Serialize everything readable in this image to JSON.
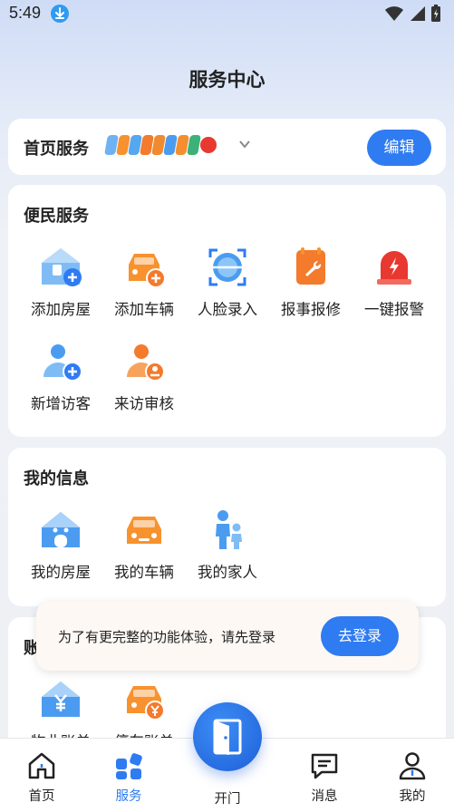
{
  "status_bar": {
    "time": "5:49"
  },
  "page_title": "服务中心",
  "home_services": {
    "title": "首页服务",
    "edit_label": "编辑"
  },
  "convenience": {
    "title": "便民服务",
    "items": [
      {
        "label": "添加房屋",
        "icon": "add-house-icon"
      },
      {
        "label": "添加车辆",
        "icon": "add-car-icon"
      },
      {
        "label": "人脸录入",
        "icon": "face-scan-icon"
      },
      {
        "label": "报事报修",
        "icon": "repair-icon"
      },
      {
        "label": "一键报警",
        "icon": "alarm-icon"
      },
      {
        "label": "新增访客",
        "icon": "add-visitor-icon"
      },
      {
        "label": "来访审核",
        "icon": "visitor-review-icon"
      }
    ]
  },
  "my_info": {
    "title": "我的信息",
    "items": [
      {
        "label": "我的房屋",
        "icon": "house-icon"
      },
      {
        "label": "我的车辆",
        "icon": "car-icon"
      },
      {
        "label": "我的家人",
        "icon": "family-icon"
      }
    ]
  },
  "bills": {
    "title_partial": "账",
    "items": [
      {
        "label": "物业账单",
        "icon": "property-bill-icon"
      },
      {
        "label": "停车账单",
        "icon": "parking-bill-icon"
      }
    ]
  },
  "login_toast": {
    "text": "为了有更完整的功能体验，请先登录",
    "button": "去登录"
  },
  "tabbar": {
    "tabs": [
      {
        "label": "首页"
      },
      {
        "label": "服务"
      },
      {
        "label": "开门"
      },
      {
        "label": "消息"
      },
      {
        "label": "我的"
      }
    ],
    "active": "服务"
  },
  "colors": {
    "accent": "#2f7bf2",
    "orange": "#f47a2c",
    "red": "#e8382f"
  }
}
